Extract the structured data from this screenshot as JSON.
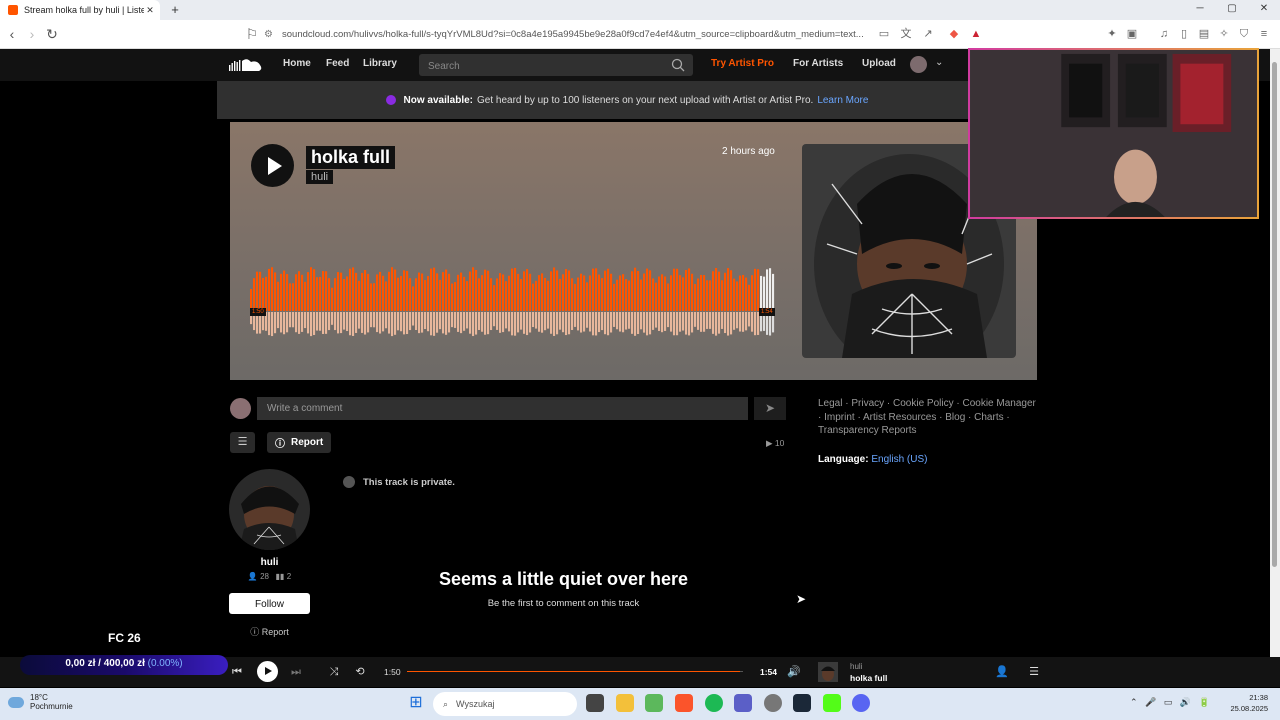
{
  "browser": {
    "tab_title": "Stream holka full by huli | Listen",
    "tab_close": "✕",
    "new_tab": "+",
    "window_controls": [
      "─",
      "▢",
      "✕"
    ],
    "url": "soundcloud.com/hulivvs/holka-full/s-tyqYrVML8Ud?si=0c8a4e195a9945be9e28a0f9cd7e4ef4&utm_source=clipboard&utm_medium=text..."
  },
  "header": {
    "nav": [
      "Home",
      "Feed",
      "Library"
    ],
    "search_placeholder": "Search",
    "try_pro": "Try Artist Pro",
    "for_artists": "For Artists",
    "upload": "Upload"
  },
  "banner": {
    "bold": "Now available:",
    "text": "Get heard by up to 100 listeners on your next upload with Artist or Artist Pro.",
    "link": "Learn More"
  },
  "track": {
    "title": "holka full",
    "artist": "huli",
    "posted": "2 hours ago",
    "wave_start": "1:50",
    "wave_end": "1:54",
    "played_fraction": 0.97
  },
  "comments": {
    "placeholder": "Write a comment",
    "report": "Report",
    "plays": "10",
    "empty_title": "Seems a little quiet over here",
    "empty_sub": "Be the first to comment on this track",
    "private_note": "This track is private."
  },
  "artist_panel": {
    "name": "huli",
    "followers": "28",
    "tracks": "2",
    "follow": "Follow",
    "report": "Report"
  },
  "footer": {
    "links": "Legal · Privacy · Cookie Policy · Cookie Manager · Imprint · Artist Resources · Blog · Charts · Transparency Reports",
    "language_label": "Language:",
    "language_value": "English (US)"
  },
  "overlay": {
    "game": "FC 26",
    "money": "0,00 zł / 400,00 zł",
    "percent": "(0.00%)"
  },
  "player": {
    "current": "1:50",
    "duration": "1:54",
    "progress_fraction": 0.99,
    "artist": "huli",
    "title": "holka full"
  },
  "taskbar": {
    "temp": "18°C",
    "weather": "Pochmurnie",
    "search": "Wyszukaj",
    "time": "21:38",
    "date": "25.08.2025"
  },
  "colors": {
    "accent": "#ff5500",
    "link": "#6aa6ff"
  }
}
